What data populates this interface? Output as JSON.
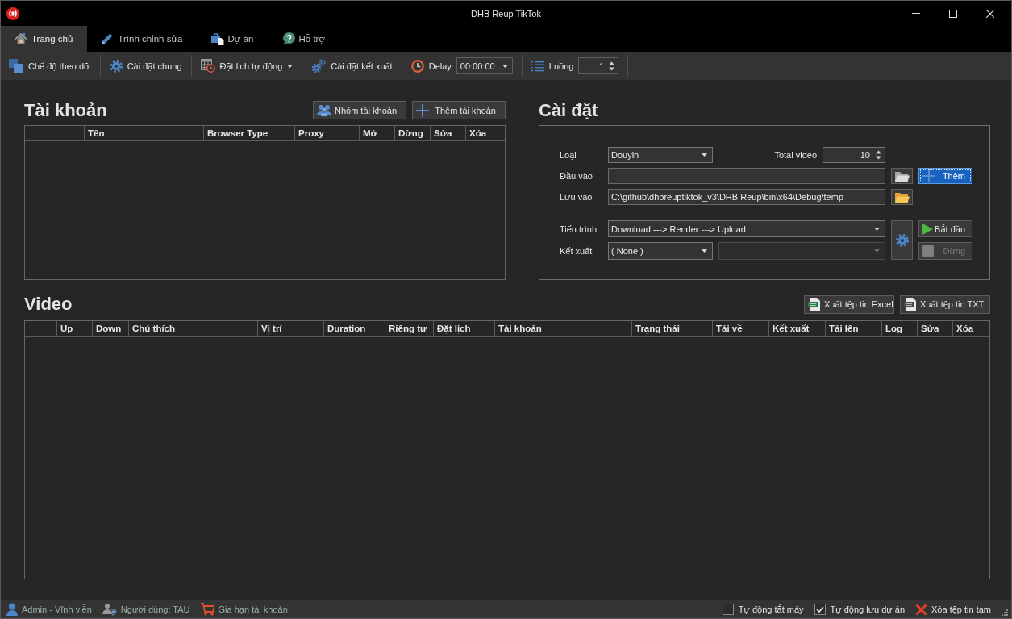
{
  "window": {
    "title": "DHB Reup TikTok"
  },
  "tabs": [
    {
      "label": "Trang chủ",
      "selected": true
    },
    {
      "label": "Trình chỉnh sửa",
      "selected": false
    },
    {
      "label": "Dự án",
      "selected": false
    },
    {
      "label": "Hỗ trợ",
      "selected": false
    }
  ],
  "toolbar": [
    {
      "kind": "button",
      "label": "Chế độ theo dõi"
    },
    {
      "kind": "button",
      "label": "Cài đặt chung"
    },
    {
      "kind": "menu",
      "label": "Đặt lịch tự động"
    },
    {
      "kind": "button",
      "label": "Cài đặt kết xuất"
    },
    {
      "kind": "time",
      "label": "Delay",
      "value": "00:00:00"
    },
    {
      "kind": "spin",
      "label": "Luồng",
      "value": "1"
    }
  ],
  "accounts": {
    "title": "Tài khoản",
    "buttons": [
      {
        "label": "Nhóm tài khoản"
      },
      {
        "label": "Thêm tài khoản"
      }
    ],
    "table": {
      "columns": [
        "Tên",
        "Browser Type",
        "Proxy",
        "Mở",
        "Dừng",
        "Sửa",
        "Xóa"
      ]
    }
  },
  "settings": {
    "title": "Cài đặt",
    "type": {
      "label": "Loại",
      "value": "Douyin"
    },
    "total_video": {
      "label": "Total video",
      "value": "10"
    },
    "input": {
      "label": "Đầu vào"
    },
    "add_button": {
      "label": "Thêm",
      "focused": true
    },
    "save_to": {
      "label": "Lưu vào",
      "value": "C:\\github\\dhbreuptiktok_v3\\DHB Reup\\bin\\x64\\Debug\\temp"
    },
    "process": {
      "label": "Tiến trình",
      "value": "Download ---> Render ---> Upload"
    },
    "render": {
      "label": "Kết xuất",
      "value": "( None )"
    },
    "render_dropdown_2": {
      "disabled": true
    },
    "run_buttons": [
      {
        "kind": "start",
        "label": "Bắt đầu",
        "disabled": false
      },
      {
        "kind": "stop",
        "label": "Dừng",
        "disabled": true
      }
    ]
  },
  "video": {
    "title": "Video",
    "buttons": [
      {
        "label": "Xuất tệp tin Excel"
      },
      {
        "label": "Xuất tệp tin TXT"
      }
    ],
    "table": {
      "columns": [
        "Up",
        "Down",
        "Chú thích",
        "Vị trí",
        "Duration",
        "Riêng tư",
        "Đặt lịch",
        "Tài khoản",
        "Trạng thái",
        "Tải về",
        "Kết xuất",
        "Tải lên",
        "Log",
        "Sửa",
        "Xóa"
      ]
    }
  },
  "status_bar": {
    "left": [
      {
        "label": "Admin - Vĩnh viễn"
      },
      {
        "label": "Người dùng: TAU"
      },
      {
        "label": "Gia hạn tài khoản"
      }
    ],
    "right": [
      {
        "kind": "checkbox",
        "label": "Tự động tắt máy",
        "checked": false
      },
      {
        "kind": "checkbox",
        "label": "Tự động lưu dự án",
        "checked": true
      },
      {
        "kind": "action",
        "label": "Xóa tệp tin tạm"
      }
    ]
  }
}
